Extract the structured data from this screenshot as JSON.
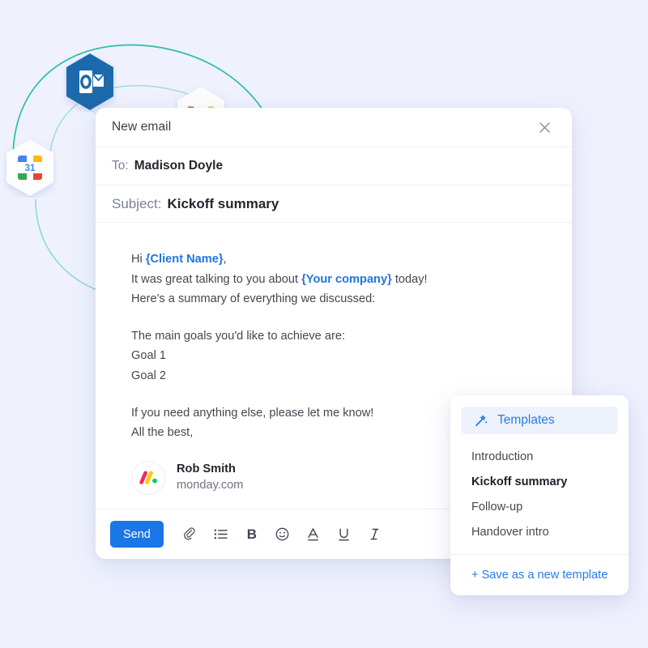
{
  "background_color": "#EFF1FD",
  "accent_color": "#1B76E8",
  "integrations": [
    {
      "name": "Outlook",
      "icon": "outlook-icon"
    },
    {
      "name": "Gmail",
      "icon": "gmail-icon"
    },
    {
      "name": "Google Calendar",
      "icon": "google-calendar-icon",
      "day": "31"
    }
  ],
  "email": {
    "header_title": "New email",
    "close_label": "✕",
    "to": {
      "label": "To:",
      "value": "Madison Doyle"
    },
    "subject": {
      "label": "Subject:",
      "value": "Kickoff summary"
    },
    "body": {
      "line1_pre": "Hi ",
      "line1_placeholder": "{Client Name}",
      "line1_post": ",",
      "line2_pre": "It was great talking to you about ",
      "line2_placeholder": "{Your company}",
      "line2_post": " today!",
      "line3": "Here's a summary of everything we discussed:",
      "line4": "The main goals you'd like to achieve are:",
      "line5": "Goal 1",
      "line6": "Goal 2",
      "line7": "If you need anything else, please let me know!",
      "line8": "All the best,"
    },
    "signature": {
      "name": "Rob Smith",
      "organization": "monday.com",
      "avatar_icon": "monday-logo-avatar"
    },
    "toolbar": {
      "send_label": "Send",
      "tools": [
        {
          "name": "attachment-icon",
          "glyph": "📎"
        },
        {
          "name": "bulleted-list-icon",
          "glyph": "☰"
        },
        {
          "name": "bold-icon",
          "glyph": "B"
        },
        {
          "name": "emoji-icon",
          "glyph": "☺"
        },
        {
          "name": "text-color-icon",
          "glyph": "A"
        },
        {
          "name": "underline-icon",
          "glyph": "U"
        },
        {
          "name": "italic-icon",
          "glyph": "I"
        }
      ]
    }
  },
  "templates": {
    "header_label": "Templates",
    "header_icon": "magic-wand-icon",
    "items": [
      {
        "label": "Introduction",
        "selected": false
      },
      {
        "label": "Kickoff summary",
        "selected": true
      },
      {
        "label": "Follow-up",
        "selected": false
      },
      {
        "label": "Handover intro",
        "selected": false
      }
    ],
    "footer_label": "+ Save as a new template"
  }
}
